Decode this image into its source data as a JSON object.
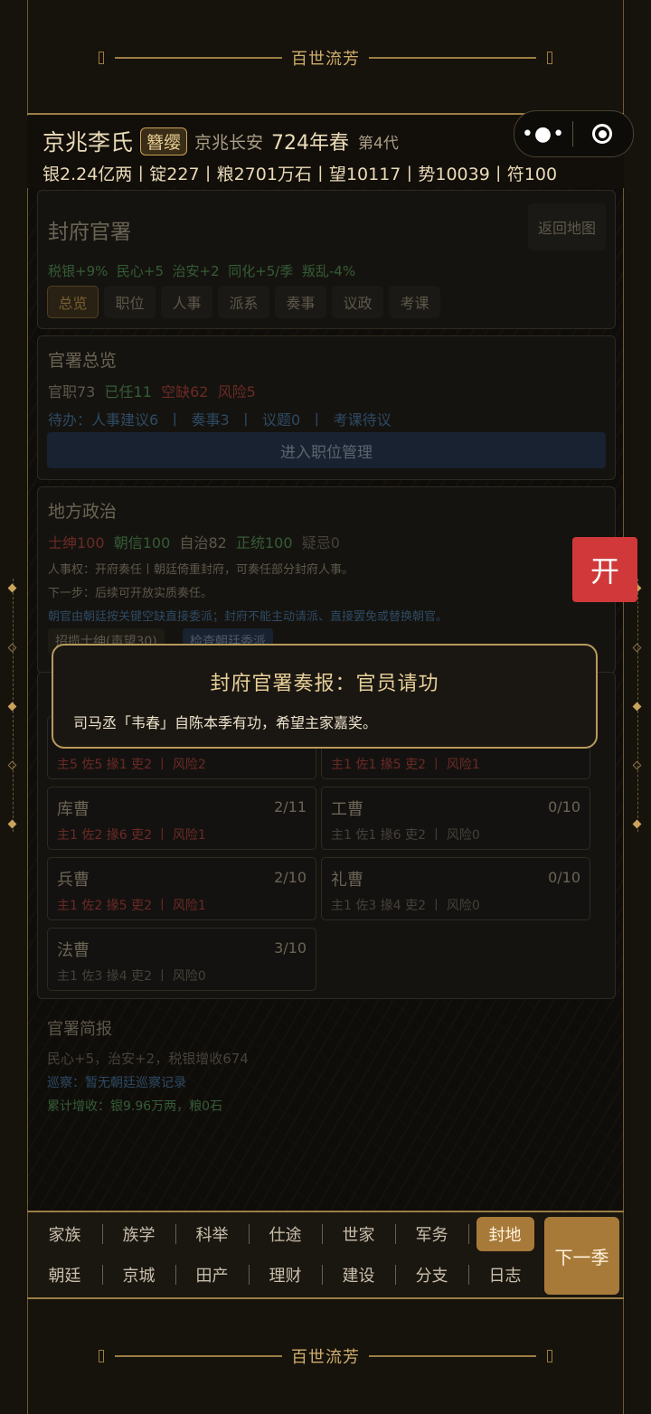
{
  "banner": {
    "title": "百世流芳"
  },
  "header": {
    "clan_name": "京兆李氏",
    "rank": "簪缨",
    "location": "京兆长安",
    "year": "724年春",
    "generation": "第4代",
    "resources": "银2.24亿两丨锭227丨粮2701万石丨望10117丨势10039丨符100"
  },
  "capsule": {
    "more": "•●•"
  },
  "office": {
    "title": "封府官署",
    "back_label": "返回地图",
    "stats": "税银+9%  民心+5  治安+2  同化+5/季  叛乱-4%",
    "tabs": [
      "总览",
      "职位",
      "人事",
      "派系",
      "奏事",
      "议政",
      "考课"
    ]
  },
  "overview": {
    "title": "官署总览",
    "posts": "官职73",
    "filled": "已任11",
    "vacant": "空缺62",
    "risk": "风险5",
    "todo": "待办：人事建议6  丨  奏事3  丨  议题0  丨  考课待议",
    "enter_label": "进入职位管理"
  },
  "local": {
    "title": "地方政治",
    "gentry": "士绅100",
    "trust": "朝信100",
    "autonomy": "自治82",
    "legitimacy": "正统100",
    "suspicion": "疑忌0",
    "line1": "人事权：开府奏任丨朝廷倚重封府，可奏任部分封府人事。",
    "line2": "下一步：后续可开放实质奏任。",
    "line3": "朝官由朝廷按关键空缺直接委派；封府不能主动请派、直接罢免或替换朝官。",
    "btn_recruit": "招揽士绅(声望30)",
    "btn_check": "检查朝廷委派"
  },
  "bureaus": [
    {
      "name": "",
      "count": "",
      "detail": "主5 佐5 掾1 吏2  丨  风险2",
      "tone": "red"
    },
    {
      "name": "",
      "count": "",
      "detail": "主1 佐1 掾5 吏2  丨  风险1",
      "tone": "red"
    },
    {
      "name": "库曹",
      "count": "2/11",
      "detail": "主1 佐2 掾6 吏2  丨  风险1",
      "tone": "red"
    },
    {
      "name": "工曹",
      "count": "0/10",
      "detail": "主1 佐1 掾6 吏2  丨  风险0",
      "tone": "muted"
    },
    {
      "name": "兵曹",
      "count": "2/10",
      "detail": "主1 佐2 掾5 吏2  丨  风险1",
      "tone": "red"
    },
    {
      "name": "礼曹",
      "count": "0/10",
      "detail": "主1 佐3 掾4 吏2  丨  风险0",
      "tone": "muted"
    },
    {
      "name": "法曹",
      "count": "3/10",
      "detail": "主1 佐3 掾4 吏2  丨  风险0",
      "tone": "muted"
    }
  ],
  "brief": {
    "title": "官署简报",
    "line1": "民心+5，治安+2，税银增收674",
    "line2": "巡察：暂无朝廷巡察记录",
    "line3": "累计增收：银9.96万两，粮0石"
  },
  "dialog": {
    "title": "封府官署奏报：官员请功",
    "body": "司马丞「韦春」自陈本季有功，希望主家嘉奖。"
  },
  "open_button": "开",
  "nav": {
    "row1": [
      "家族",
      "族学",
      "科举",
      "仕途",
      "世家",
      "军务",
      "封地"
    ],
    "row2": [
      "朝廷",
      "京城",
      "田产",
      "理财",
      "建设",
      "分支",
      "日志"
    ],
    "active": "封地",
    "next": "下一季"
  },
  "colors": {
    "accent": "#a87a3a",
    "gold": "#c9a25b",
    "open_red": "#d0383a",
    "dialog_border": "#b89a5c"
  }
}
